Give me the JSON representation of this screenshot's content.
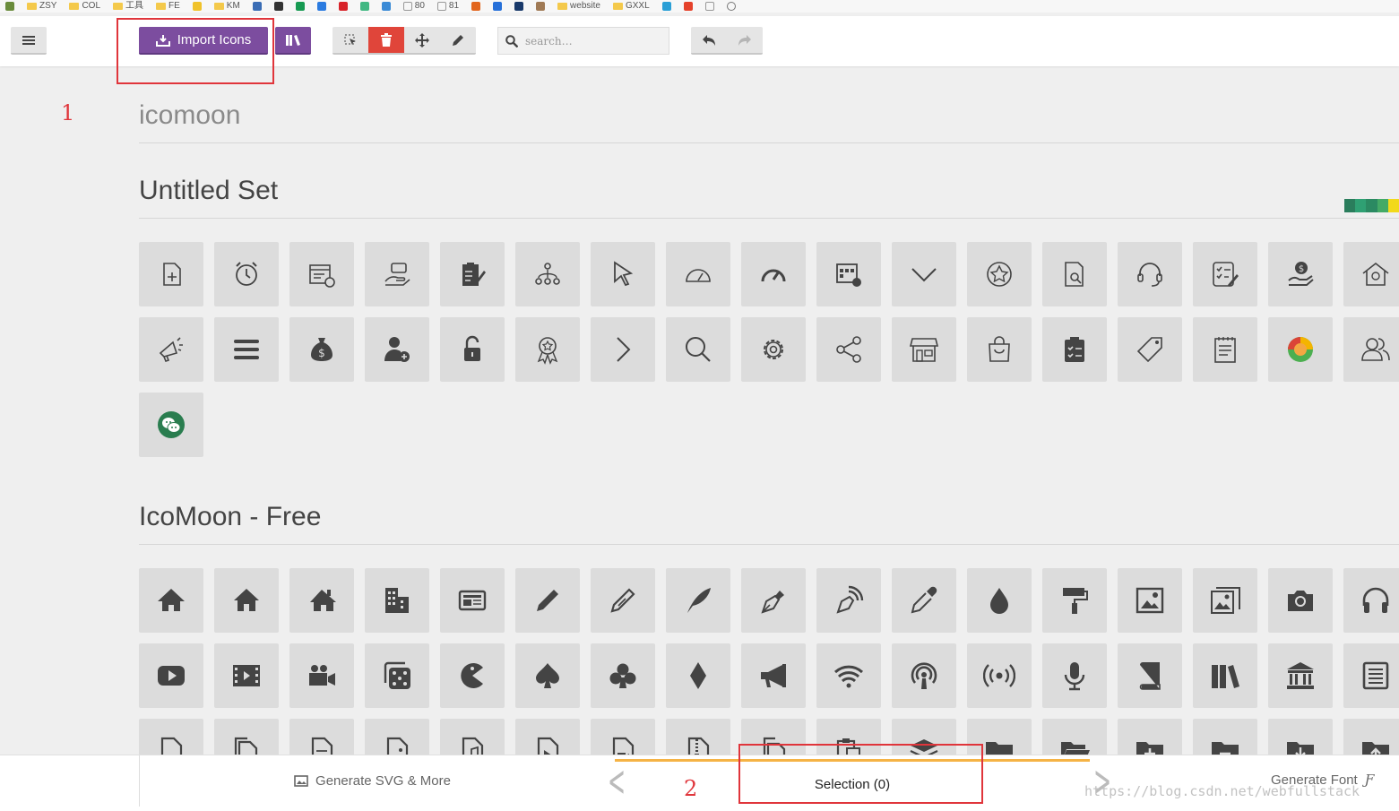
{
  "bookmarks": [
    "ZSY",
    "COL",
    "工具",
    "FE",
    "KM",
    "80",
    "81",
    "website",
    "GXXL"
  ],
  "toolbar": {
    "menu_icon": "hamburger-icon",
    "import_label": "Import Icons",
    "search_placeholder": "search…",
    "tools": [
      "select-icon",
      "delete-icon",
      "move-icon",
      "edit-icon"
    ],
    "history": [
      "undo-icon",
      "redo-icon"
    ]
  },
  "annotations": {
    "one": "1",
    "two": "2"
  },
  "sets": [
    {
      "title": "icomoon"
    },
    {
      "title": "Untitled Set"
    },
    {
      "title": "IcoMoon - Free"
    }
  ],
  "untitled_icons": [
    "file-plus",
    "alarm-clock",
    "calendar-clock",
    "hand-coin",
    "clipboard-edit",
    "org-chart",
    "cursor",
    "speedometer",
    "gauge",
    "calendar-grid",
    "chevron-down",
    "star-circle",
    "doc-search",
    "headset",
    "checklist",
    "money-hand",
    "house-coin",
    "megaphone",
    "menu-bars",
    "money-bag",
    "user-add",
    "lock-open",
    "award",
    "chevron-right",
    "search",
    "gear",
    "share",
    "store",
    "shopping-bag",
    "clipboard-check",
    "tag",
    "notepad",
    "colorful-orb",
    "users",
    "wechat"
  ],
  "free_icons": [
    "home",
    "home2",
    "home3",
    "office",
    "newspaper",
    "pencil",
    "pencil2",
    "quill",
    "pen",
    "blog",
    "eyedropper",
    "droplet",
    "paint-format",
    "image",
    "images",
    "camera",
    "headphones",
    "play",
    "film",
    "video-camera",
    "dice",
    "pacman",
    "spades",
    "clubs",
    "diamonds",
    "bullhorn",
    "connection",
    "podcast",
    "feed",
    "mic",
    "book",
    "books",
    "library",
    "file-text",
    "file-empty",
    "files-empty",
    "file-text2",
    "file-picture",
    "file-music",
    "file-play",
    "file-video",
    "file-zip",
    "copy",
    "paste",
    "stack",
    "folder",
    "folder-open",
    "folder-plus",
    "folder-minus",
    "folder-download",
    "folder-upload"
  ],
  "colors": {
    "accent": "#7c4d9f",
    "danger": "#e0453a",
    "selection": "#f5b345",
    "tile": "#dcdcdc"
  },
  "bottom": {
    "generate_svg": "Generate SVG & More",
    "selection": "Selection (0)",
    "generate_font": "Generate Font",
    "font_glyph": "Ƒ"
  },
  "watermark": "https://blog.csdn.net/webfullstack"
}
